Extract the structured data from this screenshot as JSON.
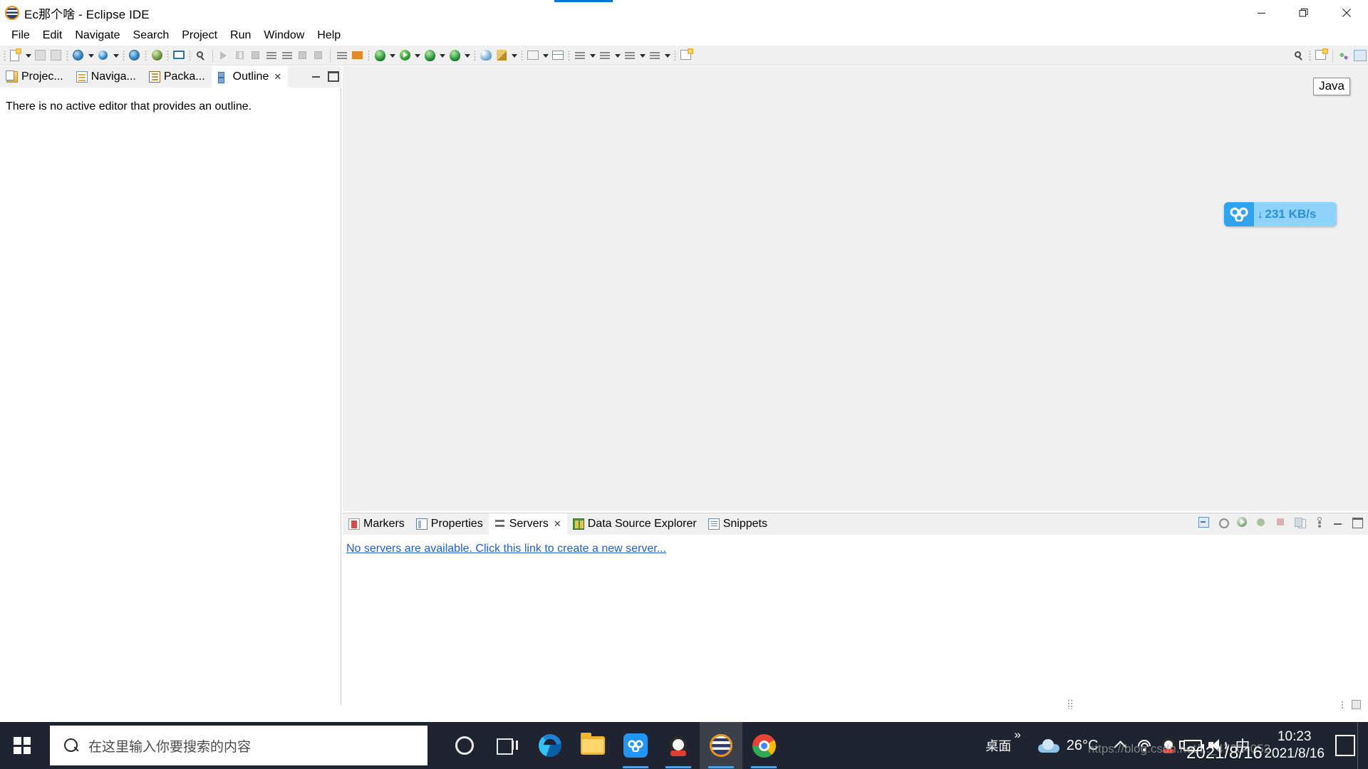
{
  "window": {
    "title": "Ec那个啥 - Eclipse IDE",
    "logo_icon": "eclipse-logo-icon",
    "minimize_label": "–",
    "restore_label": "❐",
    "close_label": "✕"
  },
  "menu": {
    "items": [
      {
        "label": "File"
      },
      {
        "label": "Edit"
      },
      {
        "label": "Navigate"
      },
      {
        "label": "Search"
      },
      {
        "label": "Project"
      },
      {
        "label": "Run"
      },
      {
        "label": "Window"
      },
      {
        "label": "Help"
      }
    ]
  },
  "toolbar": {
    "items": [
      {
        "name": "new-wizard-icon",
        "shape": "doc"
      },
      {
        "name": "new-wizard-dropdown",
        "shape": "arrow"
      },
      {
        "name": "save-icon",
        "shape": "disk"
      },
      {
        "name": "save-all-icon",
        "shape": "disk2"
      },
      {
        "name": "new-web-project-icon",
        "shape": "globe"
      },
      {
        "name": "new-web-project-dropdown",
        "shape": "arrow"
      },
      {
        "name": "new-server-icon",
        "shape": "globe-sm"
      },
      {
        "name": "new-server-dropdown",
        "shape": "arrow"
      },
      {
        "name": "open-web-browser-icon",
        "shape": "globe"
      },
      {
        "name": "debug-launch-icon",
        "shape": "debug"
      },
      {
        "name": "console-icon",
        "shape": "monitor"
      },
      {
        "name": "skip-breakpoints-icon",
        "shape": "search-tb"
      },
      {
        "name": "resume-icon",
        "shape": "play-g"
      },
      {
        "name": "suspend-icon",
        "shape": "pause"
      },
      {
        "name": "terminate-icon",
        "shape": "sq"
      },
      {
        "name": "step-into-icon",
        "shape": "lines"
      },
      {
        "name": "step-over-icon",
        "shape": "lines"
      },
      {
        "name": "step-return-icon",
        "shape": "sq"
      },
      {
        "name": "drop-to-frame-icon",
        "shape": "sq"
      },
      {
        "name": "toggle-markers-icon",
        "shape": "lines"
      },
      {
        "name": "next-annotation-icon",
        "shape": "orange-arr"
      },
      {
        "name": "external-tools-icon",
        "shape": "green-circ"
      },
      {
        "name": "external-tools-dropdown",
        "shape": "arrow"
      },
      {
        "name": "run-icon",
        "shape": "run"
      },
      {
        "name": "run-dropdown",
        "shape": "arrow"
      },
      {
        "name": "debug-icon",
        "shape": "green-circ"
      },
      {
        "name": "debug-dropdown",
        "shape": "arrow"
      },
      {
        "name": "coverage-icon",
        "shape": "green-circ"
      },
      {
        "name": "coverage-dropdown",
        "shape": "arrow"
      },
      {
        "name": "new-java-package-icon",
        "shape": "pal"
      },
      {
        "name": "new-java-class-icon",
        "shape": "pen"
      },
      {
        "name": "new-java-class-dropdown",
        "shape": "arrow"
      },
      {
        "name": "open-type-icon",
        "shape": "book"
      },
      {
        "name": "open-type-dropdown",
        "shape": "arrow"
      },
      {
        "name": "open-task-icon",
        "shape": "tbl"
      },
      {
        "name": "open-task-dropdown",
        "shape": "arrow"
      },
      {
        "name": "back-icon",
        "shape": "lines"
      },
      {
        "name": "forward-icon",
        "shape": "lines"
      },
      {
        "name": "previous-edit-icon",
        "shape": "lines"
      },
      {
        "name": "next-edit-dropdown",
        "shape": "arrow"
      },
      {
        "name": "pin-editor-icon",
        "shape": "newwin"
      }
    ],
    "right_items": [
      {
        "name": "quick-access-search-icon",
        "shape": "search-tb"
      },
      {
        "name": "open-perspective-icon",
        "shape": "newwin"
      },
      {
        "name": "perspective-javaee-icon",
        "shape": "persp-java"
      },
      {
        "name": "perspective-java-icon",
        "shape": "persp-java2"
      }
    ],
    "perspective_tooltip": "Java"
  },
  "left_panel": {
    "tabs": [
      {
        "label": "Projec...",
        "icon": "project-explorer-icon",
        "active": false,
        "closable": false
      },
      {
        "label": "Naviga...",
        "icon": "navigator-icon",
        "active": false,
        "closable": false
      },
      {
        "label": "Packa...",
        "icon": "package-explorer-icon",
        "active": false,
        "closable": false
      },
      {
        "label": "Outline",
        "icon": "outline-icon",
        "active": true,
        "closable": true
      }
    ],
    "close_glyph": "✕",
    "minimize_title": "Minimize",
    "maximize_title": "Maximize",
    "outline_message": "There is no active editor that provides an outline."
  },
  "netdisk_widget": {
    "icon": "baidu-netdisk-icon",
    "arrow": "↓",
    "speed": "231 KB/s",
    "accent_color": "#3fb0f7"
  },
  "bottom_panel": {
    "tabs": [
      {
        "label": "Markers",
        "icon": "markers-icon",
        "active": false,
        "closable": false
      },
      {
        "label": "Properties",
        "icon": "properties-icon",
        "active": false,
        "closable": false
      },
      {
        "label": "Servers",
        "icon": "servers-icon",
        "active": true,
        "closable": true
      },
      {
        "label": "Data Source Explorer",
        "icon": "data-source-explorer-icon",
        "active": false,
        "closable": false
      },
      {
        "label": "Snippets",
        "icon": "snippets-icon",
        "active": false,
        "closable": false
      }
    ],
    "close_glyph": "✕",
    "toolbar_icons": [
      {
        "name": "collapse-all-icon",
        "shape": "coll"
      },
      {
        "name": "debug-server-icon",
        "shape": "dbg"
      },
      {
        "name": "start-server-icon",
        "shape": "start"
      },
      {
        "name": "profile-server-icon",
        "shape": "prof"
      },
      {
        "name": "stop-server-icon",
        "shape": "stop"
      },
      {
        "name": "publish-server-icon",
        "shape": "publish"
      },
      {
        "name": "view-menu-icon",
        "shape": "menu"
      },
      {
        "name": "minimize-view-icon",
        "shape": "min"
      },
      {
        "name": "maximize-view-icon",
        "shape": "max"
      }
    ],
    "server_link": "No servers are available. Click this link to create a new server...",
    "link_color": "#1f5fd0"
  },
  "taskbar": {
    "start_icon": "windows-start-icon",
    "search": {
      "icon": "search-icon",
      "placeholder": "在这里输入你要搜索的内容",
      "value": ""
    },
    "apps": [
      {
        "name": "cortana-icon",
        "label": "Cortana",
        "running": false,
        "active": false
      },
      {
        "name": "task-view-icon",
        "label": "Task View",
        "running": false,
        "active": false
      },
      {
        "name": "microsoft-edge-icon",
        "label": "Microsoft Edge",
        "running": false,
        "active": false
      },
      {
        "name": "file-explorer-icon",
        "label": "File Explorer",
        "running": false,
        "active": false
      },
      {
        "name": "baidu-netdisk-icon",
        "label": "Baidu Netdisk",
        "running": true,
        "active": false
      },
      {
        "name": "qq-icon",
        "label": "QQ",
        "running": true,
        "active": false
      },
      {
        "name": "eclipse-icon",
        "label": "Eclipse IDE",
        "running": true,
        "active": true
      },
      {
        "name": "google-chrome-icon",
        "label": "Google Chrome",
        "running": true,
        "active": false
      }
    ],
    "tray": {
      "desktop_label": "桌面",
      "overflow_glyph": "»",
      "weather_icon": "cloud-icon",
      "temperature": "26°C",
      "show_hidden_icon": "chevron-up-icon",
      "wifi_icon": "wifi-icon",
      "qq_icon": "qq-tray-icon",
      "battery_icon": "battery-charging-icon",
      "volume_icon": "speaker-icon",
      "ime_label": "中",
      "time": "10:23",
      "date": "2021/8/16",
      "action_center_icon": "action-center-icon"
    }
  },
  "overlay": {
    "watermark": "https://blog.csdn.net/..._47004052",
    "datestamp": "2021/8/16"
  }
}
